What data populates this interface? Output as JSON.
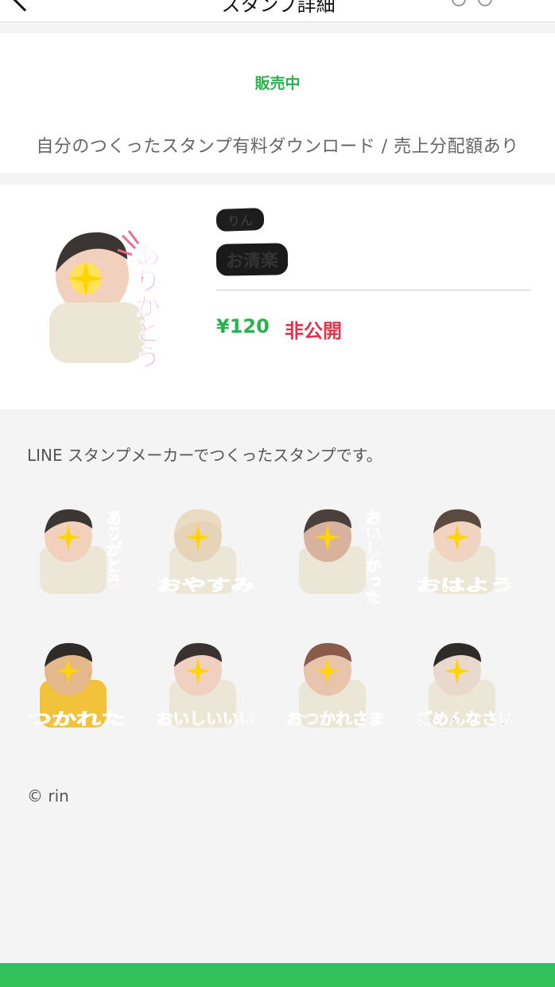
{
  "header": {
    "title": "スタンプ詳細"
  },
  "status": "販売中",
  "category": "自分のつくったスタンプ有料ダウンロード / 売上分配額あり",
  "product": {
    "creator": "りん",
    "name": "お清楽",
    "price": "¥120",
    "visibility": "非公開",
    "main_sticker": {
      "text": "ありがとう",
      "color": "#e66cc4"
    }
  },
  "description": "LINE スタンプメーカーでつくったスタンプです。",
  "stickers": [
    {
      "text": "ありがとう",
      "color": "#e66cc4"
    },
    {
      "text": "おやすみ",
      "color": "#3cc9d6"
    },
    {
      "text": "おいしかった",
      "color": "#e8742a"
    },
    {
      "text": "おはよう",
      "color": "#f2a52a"
    },
    {
      "text": "つかれた",
      "color": "#3ed47d"
    },
    {
      "text": "おいしいいい",
      "color": "#e8742a"
    },
    {
      "text": "おつかれさま",
      "color": "#e0334c"
    },
    {
      "text": "ごめんなさい",
      "color": "#111111"
    }
  ],
  "copyright": "© rin",
  "colors": {
    "accent": "#2bb24c",
    "private": "#e0334c",
    "bottom_bar": "#30c15a"
  }
}
